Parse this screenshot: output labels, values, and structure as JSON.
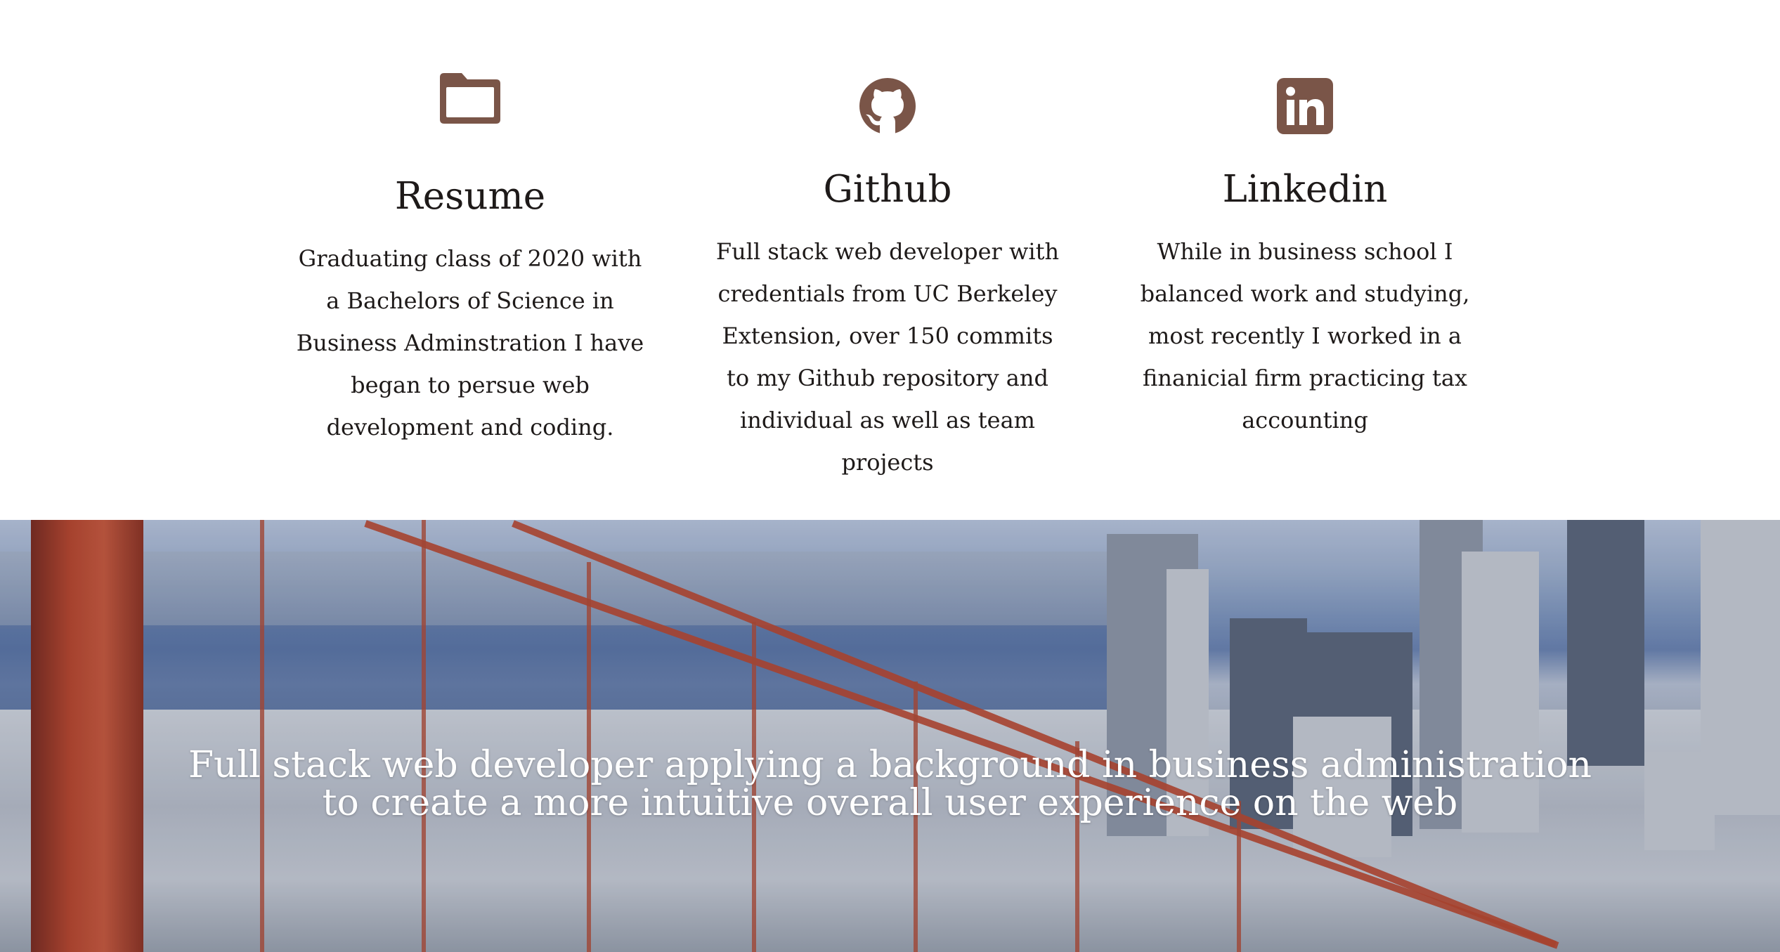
{
  "features": [
    {
      "icon": "folder-icon",
      "title": "Resume",
      "description": "Graduating class of 2020 with a Bachelors of Science in Business Adminstration I have began to persue web development and coding."
    },
    {
      "icon": "github-icon",
      "title": "Github",
      "description": "Full stack web developer with credentials from UC Berkeley Extension, over 150 commits to my Github repository and individual as well as team projects"
    },
    {
      "icon": "linkedin-icon",
      "title": "Linkedin",
      "description": "While in business school I balanced work and studying, most recently I worked in a finanicial firm practicing tax accounting"
    }
  ],
  "hero": {
    "tagline_line1": "Full stack web developer applying a background in business administration",
    "tagline_line2": "to create a more intuitive overall user experience on the web"
  },
  "colors": {
    "icon": "#7a5548",
    "text": "#1e1a19",
    "hero_text": "#ffffff"
  }
}
